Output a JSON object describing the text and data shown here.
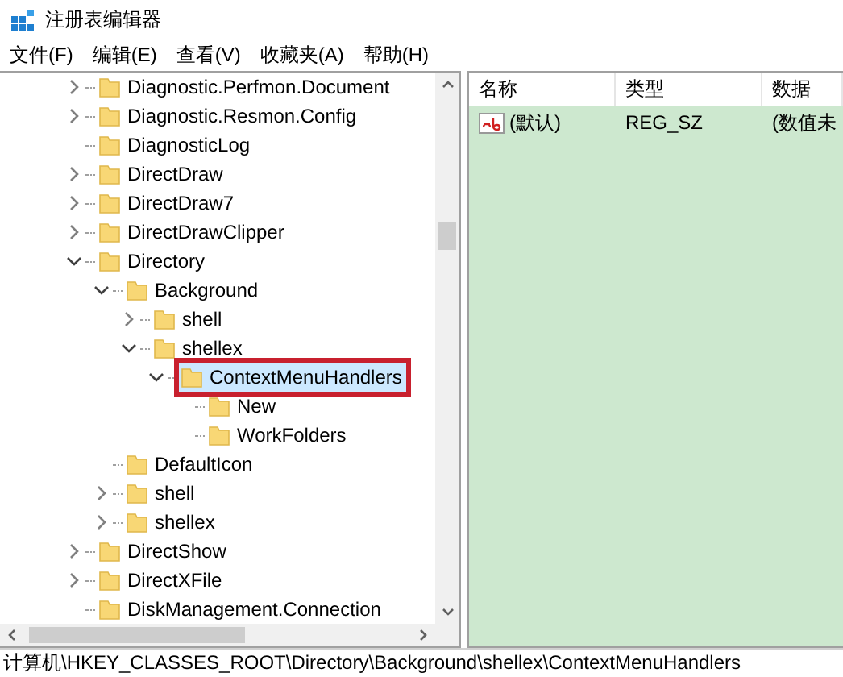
{
  "window": {
    "title": "注册表编辑器"
  },
  "menu": [
    "文件(F)",
    "编辑(E)",
    "查看(V)",
    "收藏夹(A)",
    "帮助(H)"
  ],
  "tree": [
    {
      "label": "Diagnostic.Perfmon.Document",
      "expanded": false,
      "selected": false,
      "annotated": false
    },
    {
      "label": "Diagnostic.Resmon.Config",
      "expanded": false,
      "selected": false,
      "annotated": false
    },
    {
      "label": "DiagnosticLog",
      "selected": false,
      "annotated": false
    },
    {
      "label": "DirectDraw",
      "expanded": false,
      "selected": false,
      "annotated": false
    },
    {
      "label": "DirectDraw7",
      "expanded": false,
      "selected": false,
      "annotated": false
    },
    {
      "label": "DirectDrawClipper",
      "expanded": false,
      "selected": false,
      "annotated": false
    },
    {
      "label": "Directory",
      "expanded": true,
      "selected": false,
      "annotated": false,
      "children": [
        {
          "label": "Background",
          "expanded": true,
          "selected": false,
          "annotated": false,
          "children": [
            {
              "label": "shell",
              "expanded": false,
              "selected": false,
              "annotated": false
            },
            {
              "label": "shellex",
              "expanded": true,
              "selected": false,
              "annotated": false,
              "children": [
                {
                  "label": "ContextMenuHandlers",
                  "expanded": true,
                  "selected": true,
                  "annotated": true,
                  "children": [
                    {
                      "label": "New",
                      "selected": false,
                      "annotated": false
                    },
                    {
                      "label": "WorkFolders",
                      "selected": false,
                      "annotated": false
                    }
                  ]
                }
              ]
            }
          ]
        },
        {
          "label": "DefaultIcon",
          "selected": false,
          "annotated": false
        },
        {
          "label": "shell",
          "expanded": false,
          "selected": false,
          "annotated": false
        },
        {
          "label": "shellex",
          "expanded": false,
          "selected": false,
          "annotated": false
        }
      ]
    },
    {
      "label": "DirectShow",
      "expanded": false,
      "selected": false,
      "annotated": false
    },
    {
      "label": "DirectXFile",
      "expanded": false,
      "selected": false,
      "annotated": false
    },
    {
      "label": "DiskManagement.Connection",
      "selected": false,
      "annotated": false
    }
  ],
  "values": {
    "columns": [
      "名称",
      "类型",
      "数据"
    ],
    "rows": [
      {
        "name": "(默认)",
        "type": "REG_SZ",
        "data": "(数值未"
      }
    ]
  },
  "status_bar": "计算机\\HKEY_CLASSES_ROOT\\Directory\\Background\\shellex\\ContextMenuHandlers"
}
